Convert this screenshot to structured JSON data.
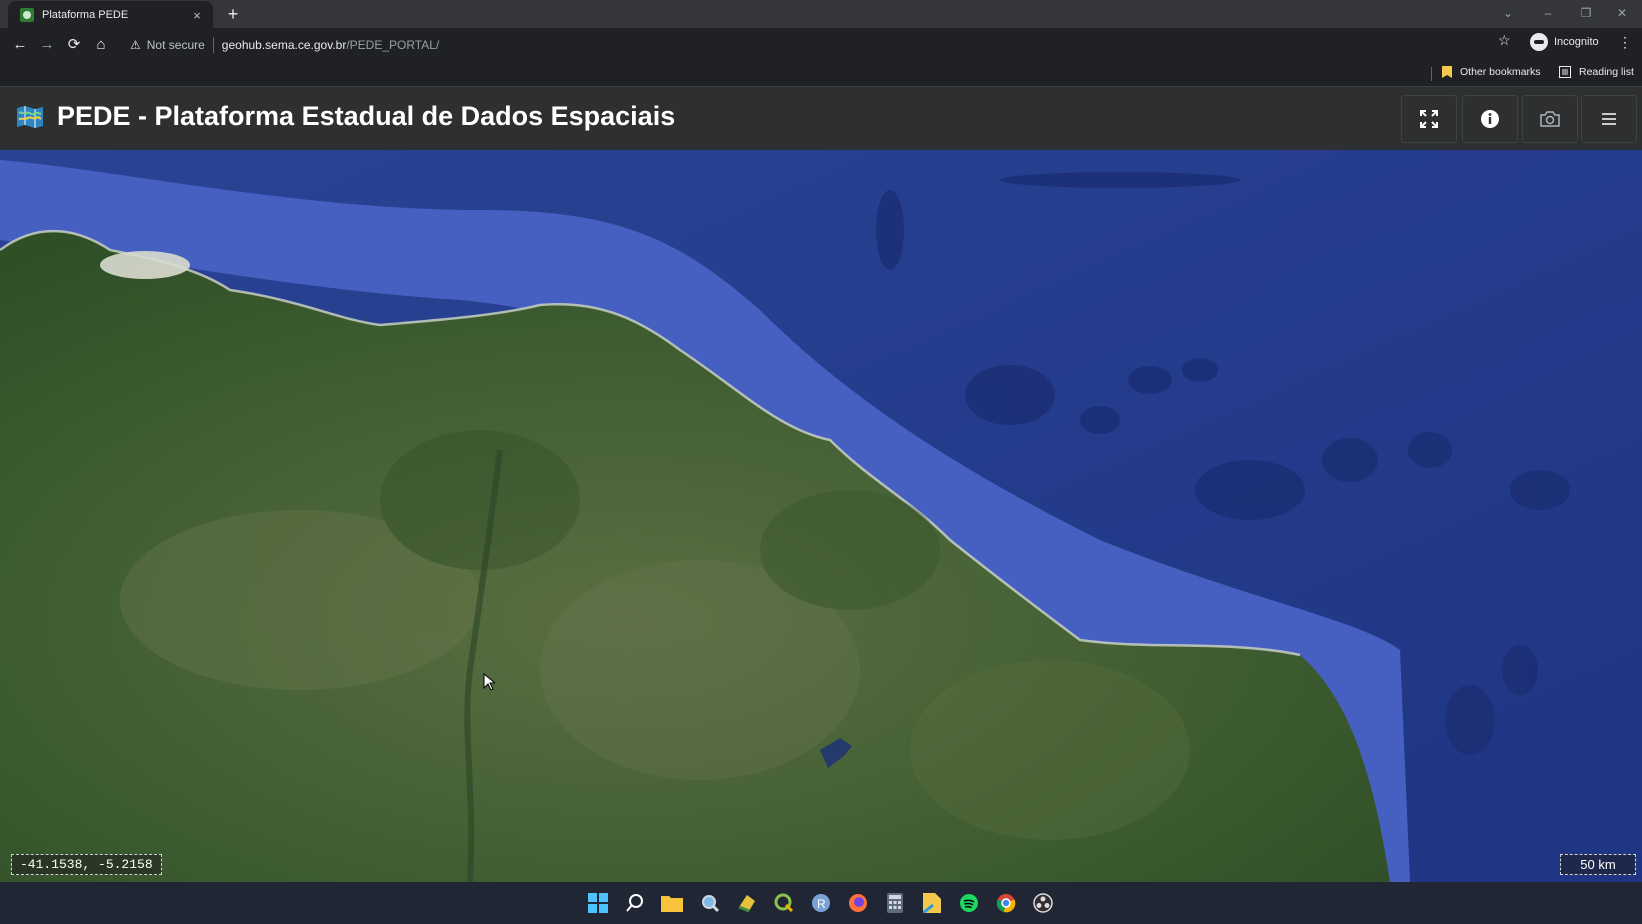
{
  "browser": {
    "tab_title": "Plataforma PEDE",
    "tab_close": "×",
    "new_tab": "+",
    "security_label": "Not secure",
    "url_host": "geohub.sema.ce.gov.br",
    "url_path": "/PEDE_PORTAL/",
    "incognito_label": "Incognito",
    "bookmarks": {
      "other": "Other bookmarks",
      "reading_list": "Reading list"
    }
  },
  "app": {
    "title": "PEDE - Plataforma Estadual de Dados Espaciais",
    "buttons": [
      "fullscreen-icon",
      "info-icon",
      "camera-icon",
      "menu-icon"
    ]
  },
  "map": {
    "coordinates": "-41.1538, -5.2158",
    "scale": "50 km",
    "colors": {
      "ocean_shelf": "#4a66c4",
      "ocean_deep": "#26408f",
      "land": "#3d5a2e"
    }
  },
  "taskbar": {
    "icons": [
      "windows-start-icon",
      "search-icon",
      "file-explorer-icon",
      "magnifier-icon",
      "geo-app-icon",
      "qgis-icon",
      "r-icon",
      "firefox-icon",
      "calculator-icon",
      "notes-icon",
      "spotify-icon",
      "chrome-icon",
      "obs-icon"
    ]
  }
}
